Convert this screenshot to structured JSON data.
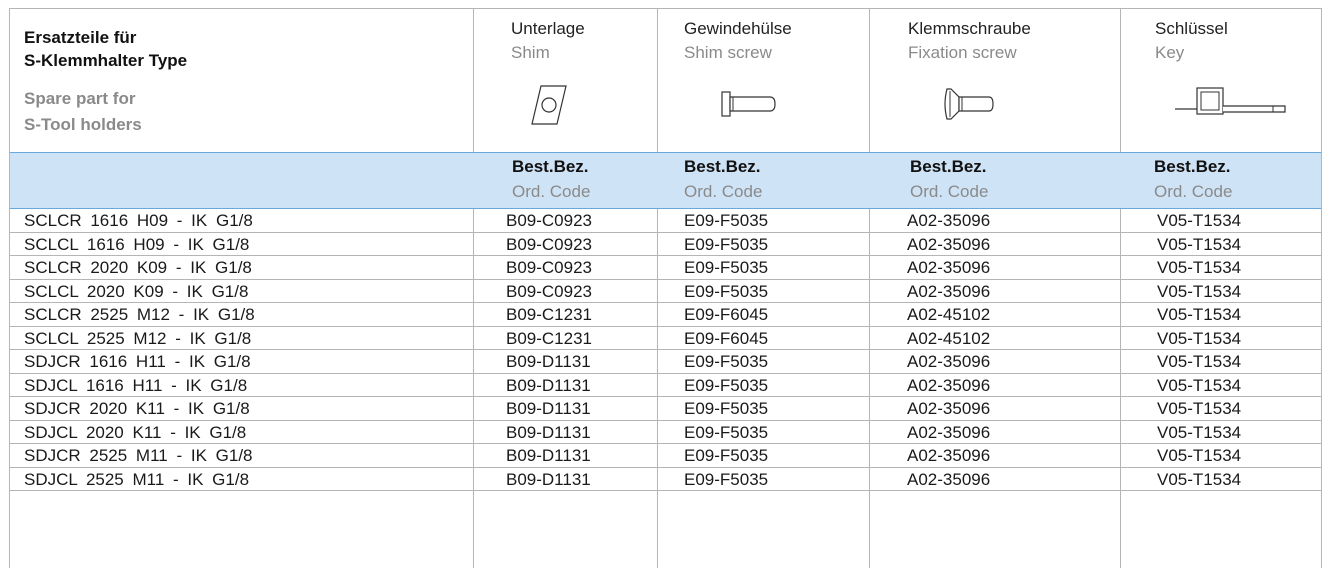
{
  "header": {
    "title_line1": "Ersatzteile für",
    "title_line2": "S-Klemmhalter Type",
    "subtitle_line1": "Spare part for",
    "subtitle_line2": "S-Tool holders"
  },
  "columns": [
    {
      "de": "Unterlage",
      "en": "Shim",
      "icon": "shim-icon"
    },
    {
      "de": "Gewindehülse",
      "en": "Shim screw",
      "icon": "shim-screw-icon"
    },
    {
      "de": "Klemmschraube",
      "en": "Fixation screw",
      "icon": "fixation-screw-icon"
    },
    {
      "de": "Schlüssel",
      "en": "Key",
      "icon": "key-icon"
    }
  ],
  "band": {
    "de": "Best.Bez.",
    "en": "Ord. Code"
  },
  "rows": [
    {
      "type": "SCLCR 1616 H09 - IK G1/8",
      "shim": "B09-C0923",
      "shim_screw": "E09-F5035",
      "fixation_screw": "A02-35096",
      "key": "V05-T1534"
    },
    {
      "type": "SCLCL 1616 H09 - IK G1/8",
      "shim": "B09-C0923",
      "shim_screw": "E09-F5035",
      "fixation_screw": "A02-35096",
      "key": "V05-T1534"
    },
    {
      "type": "SCLCR 2020 K09 - IK G1/8",
      "shim": "B09-C0923",
      "shim_screw": "E09-F5035",
      "fixation_screw": "A02-35096",
      "key": "V05-T1534"
    },
    {
      "type": "SCLCL 2020 K09 - IK G1/8",
      "shim": "B09-C0923",
      "shim_screw": "E09-F5035",
      "fixation_screw": "A02-35096",
      "key": "V05-T1534"
    },
    {
      "type": "SCLCR 2525 M12 - IK G1/8",
      "shim": "B09-C1231",
      "shim_screw": "E09-F6045",
      "fixation_screw": "A02-45102",
      "key": "V05-T1534"
    },
    {
      "type": "SCLCL 2525 M12 - IK G1/8",
      "shim": "B09-C1231",
      "shim_screw": "E09-F6045",
      "fixation_screw": "A02-45102",
      "key": "V05-T1534"
    },
    {
      "type": "SDJCR 1616 H11 - IK G1/8",
      "shim": "B09-D1131",
      "shim_screw": "E09-F5035",
      "fixation_screw": "A02-35096",
      "key": "V05-T1534"
    },
    {
      "type": "SDJCL 1616 H11 - IK G1/8",
      "shim": "B09-D1131",
      "shim_screw": "E09-F5035",
      "fixation_screw": "A02-35096",
      "key": "V05-T1534"
    },
    {
      "type": "SDJCR 2020 K11 - IK G1/8",
      "shim": "B09-D1131",
      "shim_screw": "E09-F5035",
      "fixation_screw": "A02-35096",
      "key": "V05-T1534"
    },
    {
      "type": "SDJCL 2020 K11 - IK G1/8",
      "shim": "B09-D1131",
      "shim_screw": "E09-F5035",
      "fixation_screw": "A02-35096",
      "key": "V05-T1534"
    },
    {
      "type": "SDJCR 2525 M11 - IK G1/8",
      "shim": "B09-D1131",
      "shim_screw": "E09-F5035",
      "fixation_screw": "A02-35096",
      "key": "V05-T1534"
    },
    {
      "type": "SDJCL 2525 M11 - IK G1/8",
      "shim": "B09-D1131",
      "shim_screw": "E09-F5035",
      "fixation_screw": "A02-35096",
      "key": "V05-T1534"
    }
  ],
  "colors": {
    "band": "#cfe3f6",
    "band_border": "#6aa7dd",
    "grid": "#b5b5b5",
    "muted": "#8a8a8a"
  }
}
